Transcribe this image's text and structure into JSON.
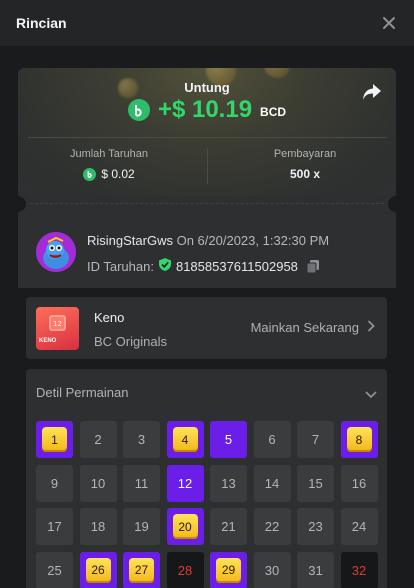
{
  "header": {
    "title": "Rincian"
  },
  "summary": {
    "profit_label": "Untung",
    "profit_amount": "+$ 10.19",
    "profit_currency": "BCD",
    "bet_label": "Jumlah Taruhan",
    "bet_amount": "$ 0.02",
    "payout_label": "Pembayaran",
    "payout_value": "500 x"
  },
  "user": {
    "name": "RisingStarGws",
    "date": "On 6/20/2023, 1:32:30 PM",
    "bet_id_label": "ID Taruhan:",
    "bet_id": "818585376115029 58"
  },
  "game": {
    "name": "Keno",
    "provider": "BC Originals",
    "play_label": "Mainkan Sekarang",
    "thumb_text": "KENO"
  },
  "detail": {
    "heading": "Detil Permainan",
    "cells": [
      {
        "n": "1",
        "state": "hit"
      },
      {
        "n": "2",
        "state": "normal"
      },
      {
        "n": "3",
        "state": "normal"
      },
      {
        "n": "4",
        "state": "hit"
      },
      {
        "n": "5",
        "state": "pick"
      },
      {
        "n": "6",
        "state": "normal"
      },
      {
        "n": "7",
        "state": "normal"
      },
      {
        "n": "8",
        "state": "hit"
      },
      {
        "n": "9",
        "state": "normal"
      },
      {
        "n": "10",
        "state": "normal"
      },
      {
        "n": "11",
        "state": "normal"
      },
      {
        "n": "12",
        "state": "pick"
      },
      {
        "n": "13",
        "state": "normal"
      },
      {
        "n": "14",
        "state": "normal"
      },
      {
        "n": "15",
        "state": "normal"
      },
      {
        "n": "16",
        "state": "normal"
      },
      {
        "n": "17",
        "state": "normal"
      },
      {
        "n": "18",
        "state": "normal"
      },
      {
        "n": "19",
        "state": "normal"
      },
      {
        "n": "20",
        "state": "hit"
      },
      {
        "n": "21",
        "state": "normal"
      },
      {
        "n": "22",
        "state": "normal"
      },
      {
        "n": "23",
        "state": "normal"
      },
      {
        "n": "24",
        "state": "normal"
      },
      {
        "n": "25",
        "state": "normal"
      },
      {
        "n": "26",
        "state": "hit"
      },
      {
        "n": "27",
        "state": "hit"
      },
      {
        "n": "28",
        "state": "red"
      },
      {
        "n": "29",
        "state": "hit"
      },
      {
        "n": "30",
        "state": "normal"
      },
      {
        "n": "31",
        "state": "normal"
      },
      {
        "n": "32",
        "state": "red"
      }
    ]
  },
  "colors": {
    "profit": "#2ed86a",
    "accent": "#6b1ee8",
    "gem": "#f3b618",
    "miss": "#e63737"
  }
}
